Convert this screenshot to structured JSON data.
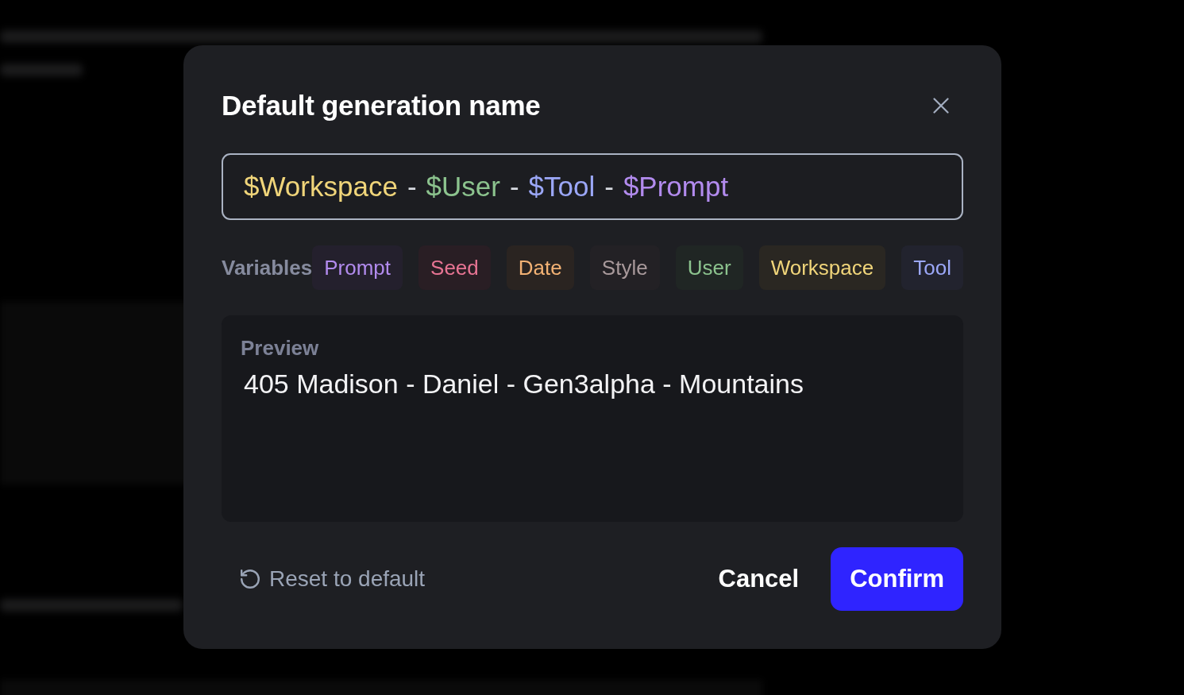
{
  "dialog": {
    "title": "Default generation name",
    "name_field": {
      "segments": [
        {
          "text": "$Workspace",
          "color": "#f0d57a"
        },
        {
          "text": "-",
          "color": "#d6d9e0"
        },
        {
          "text": "$User",
          "color": "#8cc38e"
        },
        {
          "text": "-",
          "color": "#d6d9e0"
        },
        {
          "text": "$Tool",
          "color": "#9ba7f7"
        },
        {
          "text": "-",
          "color": "#d6d9e0"
        },
        {
          "text": "$Prompt",
          "color": "#b28bee"
        }
      ]
    },
    "variables": {
      "label": "Variables",
      "items": [
        {
          "label": "Prompt",
          "color": "#b28bee"
        },
        {
          "label": "Seed",
          "color": "#e77493"
        },
        {
          "label": "Date",
          "color": "#f3b274"
        },
        {
          "label": "Style",
          "color": "#a8999b"
        },
        {
          "label": "User",
          "color": "#8cc38e"
        },
        {
          "label": "Workspace",
          "color": "#f0d57a"
        },
        {
          "label": "Tool",
          "color": "#9ba7f7"
        }
      ]
    },
    "preview": {
      "label": "Preview",
      "text": "405 Madison - Daniel - Gen3alpha - Mountains"
    },
    "footer": {
      "reset": "Reset to default",
      "cancel": "Cancel",
      "confirm": "Confirm"
    }
  }
}
